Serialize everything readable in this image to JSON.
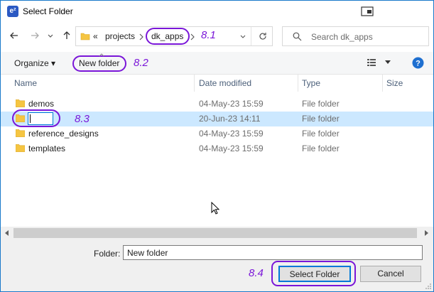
{
  "window": {
    "title": "Select Folder",
    "app_icon_text": "e²"
  },
  "navigation": {
    "breadcrumb": [
      "«",
      "projects",
      "dk_apps"
    ],
    "search_placeholder": "Search dk_apps"
  },
  "toolbar": {
    "organize_label": "Organize ▾",
    "new_folder_label": "New folder"
  },
  "columns": [
    "Name",
    "Date modified",
    "Type",
    "Size"
  ],
  "rows": [
    {
      "name": "demos",
      "date": "04-May-23 15:59",
      "type": "File folder",
      "selected": false
    },
    {
      "name": "",
      "date": "20-Jun-23 14:11",
      "type": "File folder",
      "selected": true
    },
    {
      "name": "reference_designs",
      "date": "04-May-23 15:59",
      "type": "File folder",
      "selected": false
    },
    {
      "name": "templates",
      "date": "04-May-23 15:59",
      "type": "File folder",
      "selected": false
    }
  ],
  "footer": {
    "folder_label": "Folder:",
    "folder_value": "New folder",
    "select_button": "Select Folder",
    "cancel_button": "Cancel"
  },
  "annotations": {
    "a1": "8.1",
    "a2": "8.2",
    "a3": "8.3",
    "a4": "8.4"
  },
  "colors": {
    "accent": "#0078d7",
    "annotation": "#7a16d8",
    "selection": "#cce8ff"
  }
}
